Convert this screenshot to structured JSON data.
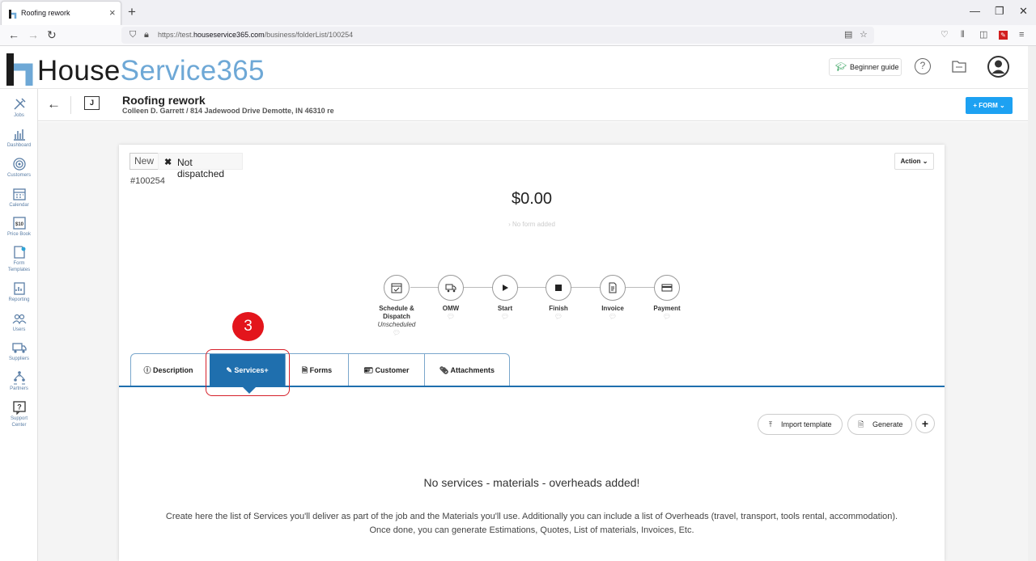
{
  "browser": {
    "tab_title": "Roofing rework",
    "new_tab": "+",
    "url_prefix": "https://test.",
    "url_domain": "houseservice365.com",
    "url_path": "/business/folderList/100254",
    "window_controls": {
      "minimize": "—",
      "restore": "❐",
      "close": "✕"
    }
  },
  "app": {
    "logo_part1": "House",
    "logo_part2": "Service365",
    "beginner_guide": "Beginner guide",
    "help": "?"
  },
  "sidebar": {
    "items": [
      {
        "label": "Jobs",
        "icon": "tools-icon"
      },
      {
        "label": "Dashboard",
        "icon": "bar-chart-icon"
      },
      {
        "label": "Customers",
        "icon": "target-icon"
      },
      {
        "label": "Calendar",
        "icon": "calendar-icon"
      },
      {
        "label": "Price Book",
        "icon": "price-tag-icon"
      },
      {
        "label": "Form",
        "label2": "Templates",
        "icon": "form-icon"
      },
      {
        "label": "Reporting",
        "icon": "report-icon"
      },
      {
        "label": "Users",
        "icon": "users-icon"
      },
      {
        "label": "Suppliers",
        "icon": "truck-icon"
      },
      {
        "label": "Partners",
        "icon": "partners-icon"
      },
      {
        "label": "Support",
        "label2": "Center",
        "icon": "support-icon"
      }
    ]
  },
  "job": {
    "badge": "J",
    "title": "Roofing rework",
    "subtitle": "Colleen D. Garrett / 814 Jadewood Drive Demotte, IN 46310 re",
    "form_button": "+ FORM ⌄",
    "status_new": "New",
    "dispatch_status": "Not dispatched",
    "number": "#100254",
    "action_button": "Action ⌄",
    "total": "$0.00",
    "no_form": "No form added"
  },
  "steps": [
    {
      "label": "Schedule &",
      "label2": "Dispatch",
      "sub": "Unscheduled",
      "icon": "calendar-check-icon"
    },
    {
      "label": "OMW",
      "icon": "truck-icon"
    },
    {
      "label": "Start",
      "icon": "play-icon"
    },
    {
      "label": "Finish",
      "icon": "stop-icon"
    },
    {
      "label": "Invoice",
      "icon": "invoice-icon"
    },
    {
      "label": "Payment",
      "icon": "card-icon"
    }
  ],
  "tabs": [
    {
      "label": "Description",
      "icon": "info-icon",
      "active": false
    },
    {
      "label": "Services+",
      "icon": "pencil-icon",
      "active": true
    },
    {
      "label": "Forms",
      "icon": "doc-icon",
      "active": false
    },
    {
      "label": "Customer",
      "icon": "id-card-icon",
      "active": false
    },
    {
      "label": "Attachments",
      "icon": "paperclip-icon",
      "active": false
    }
  ],
  "callout_number": "3",
  "services": {
    "import_template": "Import template",
    "generate": "Generate",
    "add": "+",
    "empty_title": "No services - materials - overheads added!",
    "empty_desc_line1": "Create here the list of Services you'll deliver as part of the job and the Materials you'll use. Additionally you can include a list of Overheads (travel, transport, tools rental, accommodation).",
    "empty_desc_line2": "Once done, you can generate Estimations, Quotes, List of materials, Invoices, Etc."
  },
  "colors": {
    "brand_blue": "#6ea8d6",
    "active_tab": "#1f6fae",
    "form_button": "#1da1f2",
    "callout_red": "#e3151c"
  }
}
